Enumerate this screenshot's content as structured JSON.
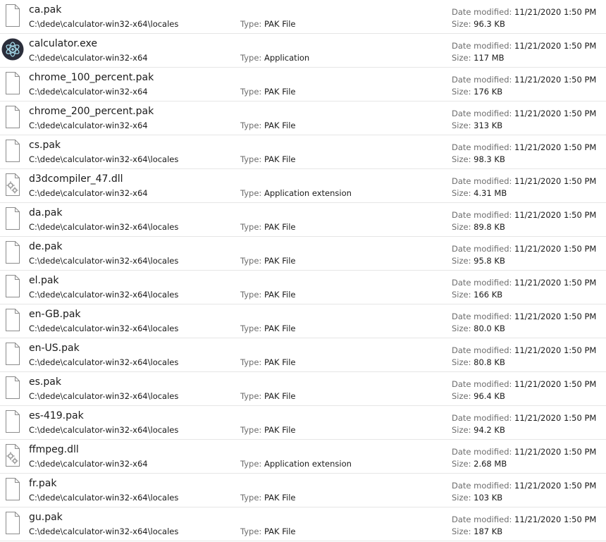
{
  "labels": {
    "type": "Type:",
    "date_modified": "Date modified:",
    "size": "Size:"
  },
  "files": [
    {
      "name": "ca.pak",
      "path": "C:\\dede\\calculator-win32-x64\\locales",
      "type": "PAK File",
      "date": "11/21/2020 1:50 PM",
      "size": "96.3 KB",
      "icon": "generic-file-icon"
    },
    {
      "name": "calculator.exe",
      "path": "C:\\dede\\calculator-win32-x64",
      "type": "Application",
      "date": "11/21/2020 1:50 PM",
      "size": "117 MB",
      "icon": "electron-app-icon"
    },
    {
      "name": "chrome_100_percent.pak",
      "path": "C:\\dede\\calculator-win32-x64",
      "type": "PAK File",
      "date": "11/21/2020 1:50 PM",
      "size": "176 KB",
      "icon": "generic-file-icon"
    },
    {
      "name": "chrome_200_percent.pak",
      "path": "C:\\dede\\calculator-win32-x64",
      "type": "PAK File",
      "date": "11/21/2020 1:50 PM",
      "size": "313 KB",
      "icon": "generic-file-icon"
    },
    {
      "name": "cs.pak",
      "path": "C:\\dede\\calculator-win32-x64\\locales",
      "type": "PAK File",
      "date": "11/21/2020 1:50 PM",
      "size": "98.3 KB",
      "icon": "generic-file-icon"
    },
    {
      "name": "d3dcompiler_47.dll",
      "path": "C:\\dede\\calculator-win32-x64",
      "type": "Application extension",
      "date": "11/21/2020 1:50 PM",
      "size": "4.31 MB",
      "icon": "dll-gear-icon"
    },
    {
      "name": "da.pak",
      "path": "C:\\dede\\calculator-win32-x64\\locales",
      "type": "PAK File",
      "date": "11/21/2020 1:50 PM",
      "size": "89.8 KB",
      "icon": "generic-file-icon"
    },
    {
      "name": "de.pak",
      "path": "C:\\dede\\calculator-win32-x64\\locales",
      "type": "PAK File",
      "date": "11/21/2020 1:50 PM",
      "size": "95.8 KB",
      "icon": "generic-file-icon"
    },
    {
      "name": "el.pak",
      "path": "C:\\dede\\calculator-win32-x64\\locales",
      "type": "PAK File",
      "date": "11/21/2020 1:50 PM",
      "size": "166 KB",
      "icon": "generic-file-icon"
    },
    {
      "name": "en-GB.pak",
      "path": "C:\\dede\\calculator-win32-x64\\locales",
      "type": "PAK File",
      "date": "11/21/2020 1:50 PM",
      "size": "80.0 KB",
      "icon": "generic-file-icon"
    },
    {
      "name": "en-US.pak",
      "path": "C:\\dede\\calculator-win32-x64\\locales",
      "type": "PAK File",
      "date": "11/21/2020 1:50 PM",
      "size": "80.8 KB",
      "icon": "generic-file-icon"
    },
    {
      "name": "es.pak",
      "path": "C:\\dede\\calculator-win32-x64\\locales",
      "type": "PAK File",
      "date": "11/21/2020 1:50 PM",
      "size": "96.4 KB",
      "icon": "generic-file-icon"
    },
    {
      "name": "es-419.pak",
      "path": "C:\\dede\\calculator-win32-x64\\locales",
      "type": "PAK File",
      "date": "11/21/2020 1:50 PM",
      "size": "94.2 KB",
      "icon": "generic-file-icon"
    },
    {
      "name": "ffmpeg.dll",
      "path": "C:\\dede\\calculator-win32-x64",
      "type": "Application extension",
      "date": "11/21/2020 1:50 PM",
      "size": "2.68 MB",
      "icon": "dll-gear-icon"
    },
    {
      "name": "fr.pak",
      "path": "C:\\dede\\calculator-win32-x64\\locales",
      "type": "PAK File",
      "date": "11/21/2020 1:50 PM",
      "size": "103 KB",
      "icon": "generic-file-icon"
    },
    {
      "name": "gu.pak",
      "path": "C:\\dede\\calculator-win32-x64\\locales",
      "type": "PAK File",
      "date": "11/21/2020 1:50 PM",
      "size": "187 KB",
      "icon": "generic-file-icon"
    }
  ]
}
